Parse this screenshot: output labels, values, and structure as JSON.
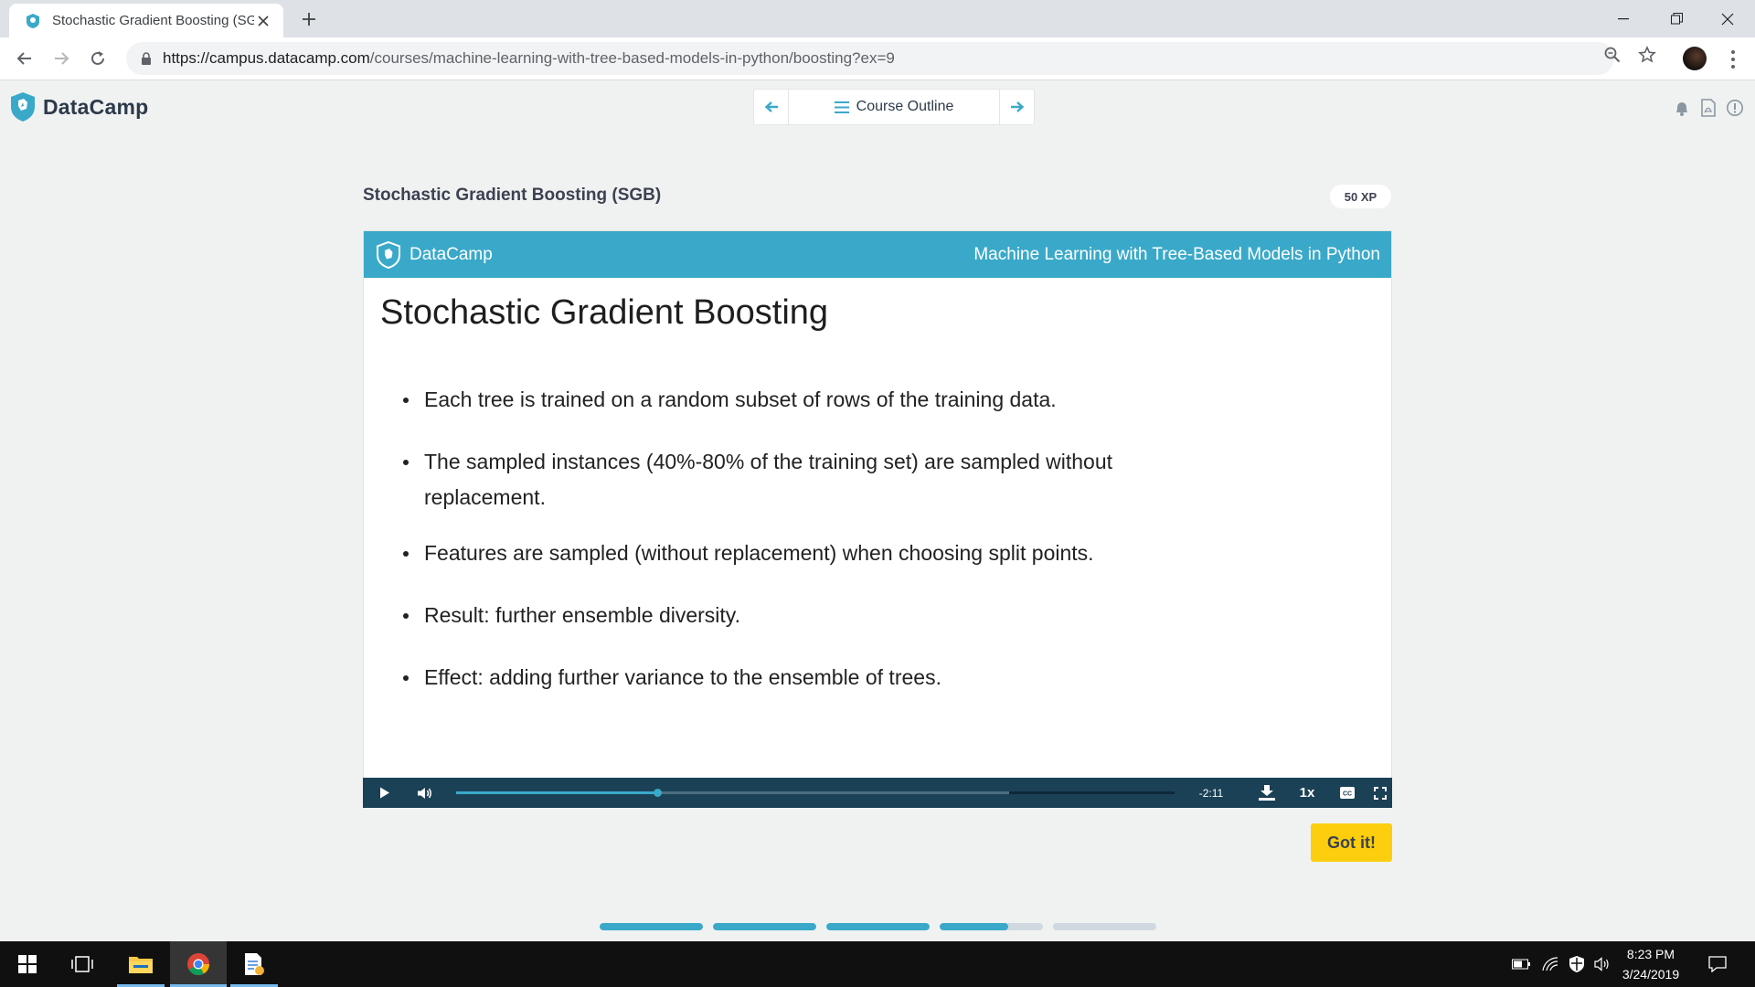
{
  "browser": {
    "tab_title": "Stochastic Gradient Boosting (SG",
    "url_host": "https://campus.datacamp.com",
    "url_path": "/courses/machine-learning-with-tree-based-models-in-python/boosting?ex=9"
  },
  "app": {
    "logo_text": "DataCamp",
    "course_outline_label": "Course Outline"
  },
  "exercise": {
    "title": "Stochastic Gradient Boosting (SGB)",
    "xp": "50 XP",
    "got_it_label": "Got it!"
  },
  "slide": {
    "brand": "DataCamp",
    "course_name": "Machine Learning with Tree-Based Models in Python",
    "title": "Stochastic Gradient Boosting",
    "bullets": [
      "Each tree is trained on a random subset of rows of the training data.",
      "The sampled instances (40%-80% of the training set) are sampled without replacement.",
      "Features are sampled (without replacement) when choosing split points.",
      "Result: further ensemble diversity.",
      "Effect: adding further variance to the ensemble of trees."
    ]
  },
  "player": {
    "time_remaining": "-2:11",
    "speed": "1x",
    "played_fraction": 0.28,
    "buffered_fraction": 0.77
  },
  "lesson_progress": [
    1,
    1,
    1,
    0.66,
    0
  ],
  "taskbar": {
    "time": "8:23 PM",
    "date": "3/24/2019"
  },
  "colors": {
    "brand_blue": "#3aa9c9",
    "button_yellow": "#fcce0d",
    "player_bg": "#1b4156"
  }
}
